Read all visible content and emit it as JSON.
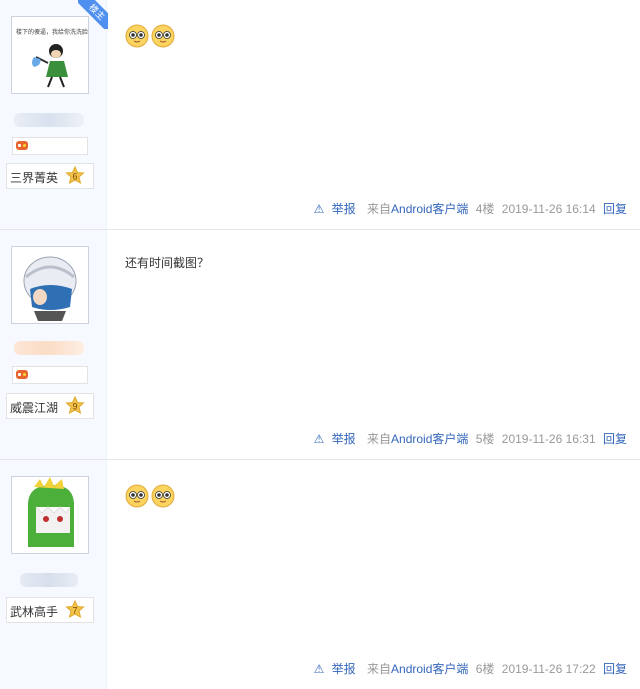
{
  "posts": [
    {
      "is_op": true,
      "op_label": "楼主",
      "avatar_caption": "楼下的傻逼，我给你洗洗脸",
      "level_title": "三界菁英",
      "level": "6",
      "content_text": "",
      "emoji_count": 2,
      "report": "举报",
      "source_prefix": "来自",
      "source_link": "Android客户端",
      "floor": "4楼",
      "time": "2019-11-26 16:14",
      "reply": "回复"
    },
    {
      "is_op": false,
      "level_title": "威震江湖",
      "level": "9",
      "content_text": "还有时间截图？",
      "emoji_count": 0,
      "report": "举报",
      "source_prefix": "来自",
      "source_link": "Android客户端",
      "floor": "5楼",
      "time": "2019-11-26 16:31",
      "reply": "回复"
    },
    {
      "is_op": false,
      "level_title": "武林高手",
      "level": "7",
      "content_text": "",
      "emoji_count": 2,
      "report": "举报",
      "source_prefix": "来自",
      "source_link": "Android客户端",
      "floor": "6楼",
      "time": "2019-11-26 17:22",
      "reply": "回复"
    }
  ],
  "colors": {
    "link": "#3366bb",
    "sidebar": "#f6f9ff",
    "op_ribbon": "#4f8ff0"
  }
}
